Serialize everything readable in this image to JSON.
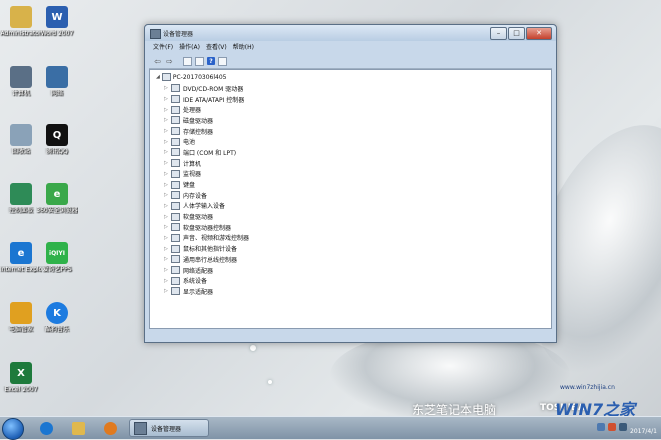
{
  "desktop_icons": [
    {
      "label": "Administrator",
      "glyph": "",
      "color": "#d8b24a"
    },
    {
      "label": "Word 2007",
      "glyph": "W",
      "color": "#2b5fb0"
    },
    {
      "label": "计算机",
      "glyph": "",
      "color": "#5a6f86"
    },
    {
      "label": "网络",
      "glyph": "",
      "color": "#3a6ea5"
    },
    {
      "label": "回收站",
      "glyph": "",
      "color": "#8aa2b8"
    },
    {
      "label": "腾讯QQ",
      "glyph": "Q",
      "color": "#111111"
    },
    {
      "label": "控制面板",
      "glyph": "",
      "color": "#2e8b57"
    },
    {
      "label": "360安全浏览器",
      "glyph": "e",
      "color": "#3aa84a"
    },
    {
      "label": "Internet Explorer",
      "glyph": "e",
      "color": "#1b76d1"
    },
    {
      "label": "爱奇艺PPS",
      "glyph": "iQIYI",
      "color": "#2fb24a"
    },
    {
      "label": "电脑管家",
      "glyph": "",
      "color": "#e0a020"
    },
    {
      "label": "酷狗音乐",
      "glyph": "K",
      "color": "#1d7be0"
    },
    {
      "label": "Excel 2007",
      "glyph": "X",
      "color": "#1e7a3c"
    }
  ],
  "window": {
    "title": "设备管理器",
    "menus": [
      "文件(F)",
      "操作(A)",
      "查看(V)",
      "帮助(H)"
    ],
    "tree_root": "PC-20170306l405",
    "devices": [
      "DVD/CD-ROM 驱动器",
      "IDE ATA/ATAPI 控制器",
      "处理器",
      "磁盘驱动器",
      "存储控制器",
      "电池",
      "端口 (COM 和 LPT)",
      "计算机",
      "监视器",
      "键盘",
      "内存设备",
      "人体学输入设备",
      "软盘驱动器",
      "软盘驱动器控制器",
      "声音、视频和游戏控制器",
      "鼠标和其他指针设备",
      "通用串行总线控制器",
      "网络适配器",
      "系统设备",
      "显示适配器"
    ]
  },
  "taskbar": {
    "active_item": "设备管理器",
    "clock_date": "2017/4/1"
  },
  "branding": {
    "brand_text": "东芝笔记本电脑",
    "toshiba": "TOSHIBA",
    "win7_logo": "WIN7之家",
    "win7_url": "www.win7zhijia.cn"
  }
}
